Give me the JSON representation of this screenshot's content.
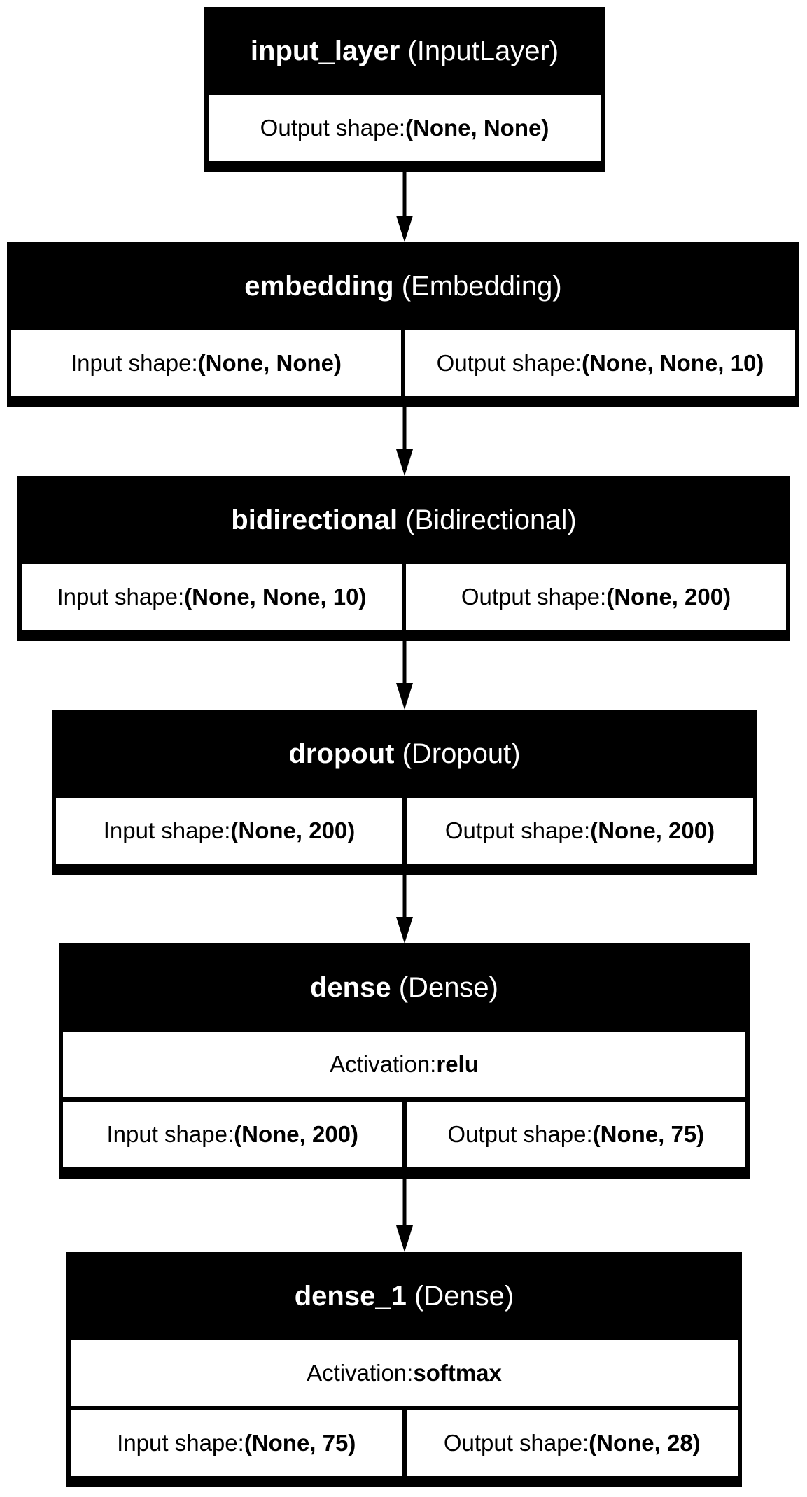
{
  "layers": [
    {
      "name": "input_layer",
      "type": "(InputLayer)",
      "rows": [
        [
          {
            "label": "Output shape: ",
            "value": "(None, None)"
          }
        ]
      ]
    },
    {
      "name": "embedding",
      "type": "(Embedding)",
      "rows": [
        [
          {
            "label": "Input shape: ",
            "value": "(None, None)"
          },
          {
            "label": "Output shape: ",
            "value": "(None, None, 10)"
          }
        ]
      ]
    },
    {
      "name": "bidirectional",
      "type": "(Bidirectional)",
      "rows": [
        [
          {
            "label": "Input shape: ",
            "value": "(None, None, 10)"
          },
          {
            "label": "Output shape: ",
            "value": "(None, 200)"
          }
        ]
      ]
    },
    {
      "name": "dropout",
      "type": "(Dropout)",
      "rows": [
        [
          {
            "label": "Input shape: ",
            "value": "(None, 200)"
          },
          {
            "label": "Output shape: ",
            "value": "(None, 200)"
          }
        ]
      ]
    },
    {
      "name": "dense",
      "type": "(Dense)",
      "rows": [
        [
          {
            "label": "Activation: ",
            "value": "relu"
          }
        ],
        [
          {
            "label": "Input shape: ",
            "value": "(None, 200)"
          },
          {
            "label": "Output shape: ",
            "value": "(None, 75)"
          }
        ]
      ]
    },
    {
      "name": "dense_1",
      "type": "(Dense)",
      "rows": [
        [
          {
            "label": "Activation: ",
            "value": "softmax"
          }
        ],
        [
          {
            "label": "Input shape: ",
            "value": "(None, 75)"
          },
          {
            "label": "Output shape: ",
            "value": "(None, 28)"
          }
        ]
      ]
    }
  ]
}
